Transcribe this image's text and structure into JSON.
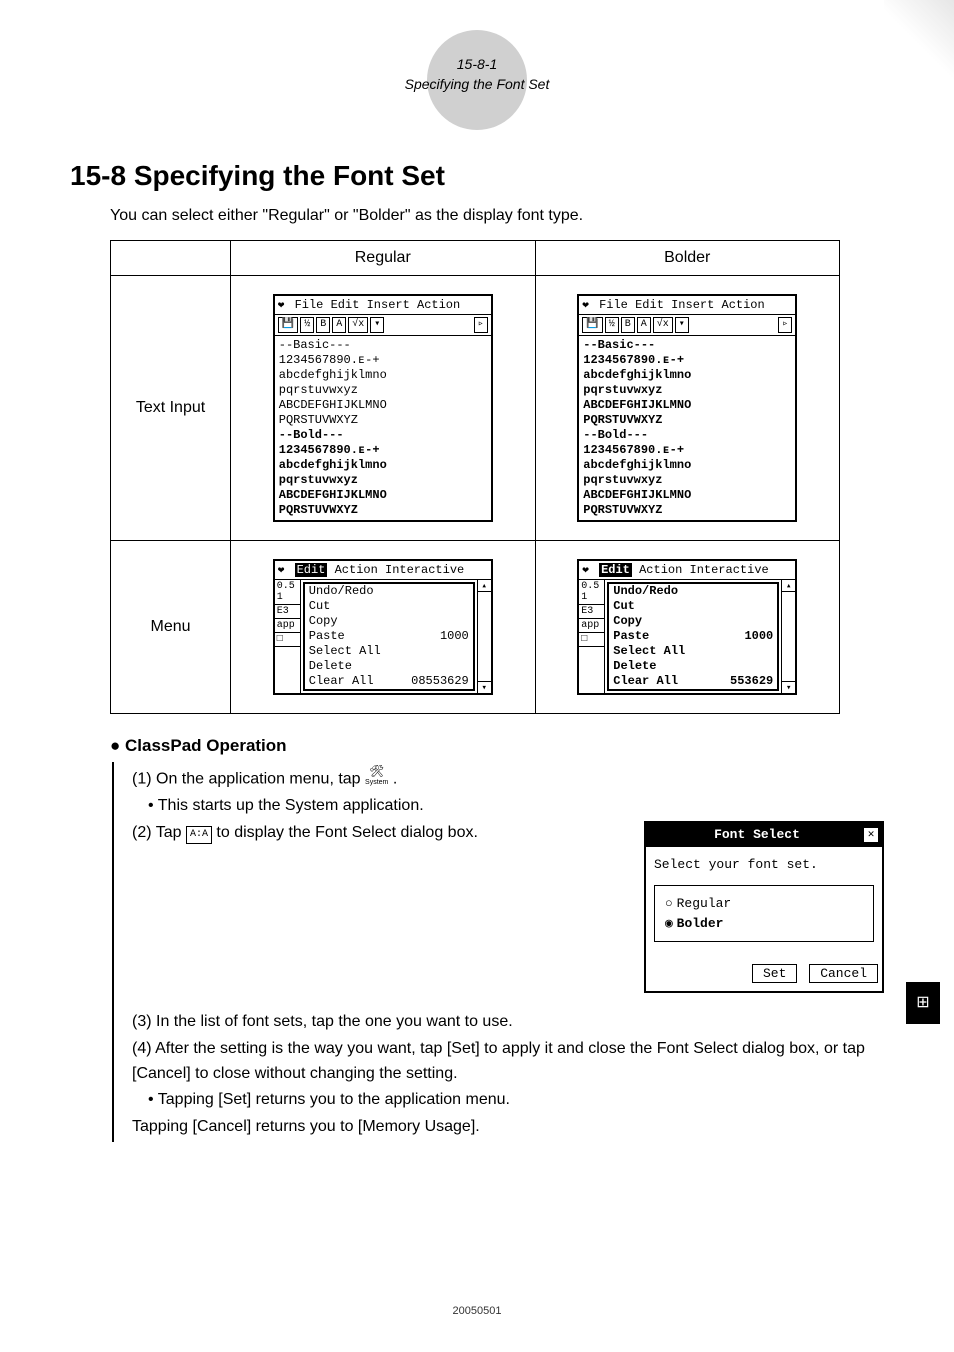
{
  "header": {
    "page_no": "15-8-1",
    "running_title": "Specifying the Font Set"
  },
  "title": "15-8 Specifying the Font Set",
  "intro": "You can select either \"Regular\" or \"Bolder\" as the display font type.",
  "table": {
    "col_regular": "Regular",
    "col_bolder": "Bolder",
    "row_textinput": "Text Input",
    "row_menu": "Menu"
  },
  "screenshots": {
    "textinput": {
      "menubar": "File Edit Insert Action",
      "lines_basic_hdr": "--Basic---",
      "l1": "1234567890.ᴇ-+",
      "l2": "abcdefghijklmno",
      "l3": "pqrstuvwxyz",
      "l4": "ABCDEFGHIJKLMNO",
      "l5": "PQRSTUVWXYZ",
      "lines_bold_hdr": "--Bold---",
      "b1": "1234567890.ᴇ-+",
      "b2": "abcdefghijklmno",
      "b3": "pqrstuvwxyz",
      "b4": "ABCDEFGHIJKLMNO",
      "b5": "PQRSTUVWXYZ",
      "tb_b": "B",
      "tb_a": "A"
    },
    "menu": {
      "menubar_edit": "Edit",
      "menubar_rest": "Action Interactive",
      "items": {
        "undo": "Undo/Redo",
        "cut": "Cut",
        "copy": "Copy",
        "paste": "Paste",
        "selectall": "Select All",
        "delete": "Delete",
        "clearall": "Clear All"
      },
      "num_regular_a": "1000",
      "num_regular_b": "08553629",
      "num_bolder_a": "1000",
      "num_bolder_b": "553629",
      "left_labels": {
        "a": "0.5 1",
        "b": "E3",
        "c": "app",
        "d": "□"
      }
    }
  },
  "operation": {
    "heading": "ClassPad Operation",
    "step1": "(1) On the application menu, tap ",
    "step1_post": ".",
    "step1_sub": "This starts up the System application.",
    "step2_pre": "(2) Tap ",
    "step2_icon": "A:A",
    "step2_post": " to display the Font Select dialog box.",
    "step3": "(3) In the list of font sets, tap the one you want to use.",
    "step4": "(4) After the setting is the way you want, tap [Set] to apply it and close the Font Select dialog box, or tap [Cancel] to close without changing the setting.",
    "step4_sub1": "Tapping [Set] returns you to the application menu.",
    "step4_sub2": "Tapping [Cancel] returns you to [Memory Usage].",
    "sys_label": "System"
  },
  "dialog": {
    "title": "Font Select",
    "prompt": "Select your font set.",
    "opt_regular": "Regular",
    "opt_bolder": "Bolder",
    "btn_set": "Set",
    "btn_cancel": "Cancel"
  },
  "footer": "20050501",
  "side_tab": "⊞"
}
